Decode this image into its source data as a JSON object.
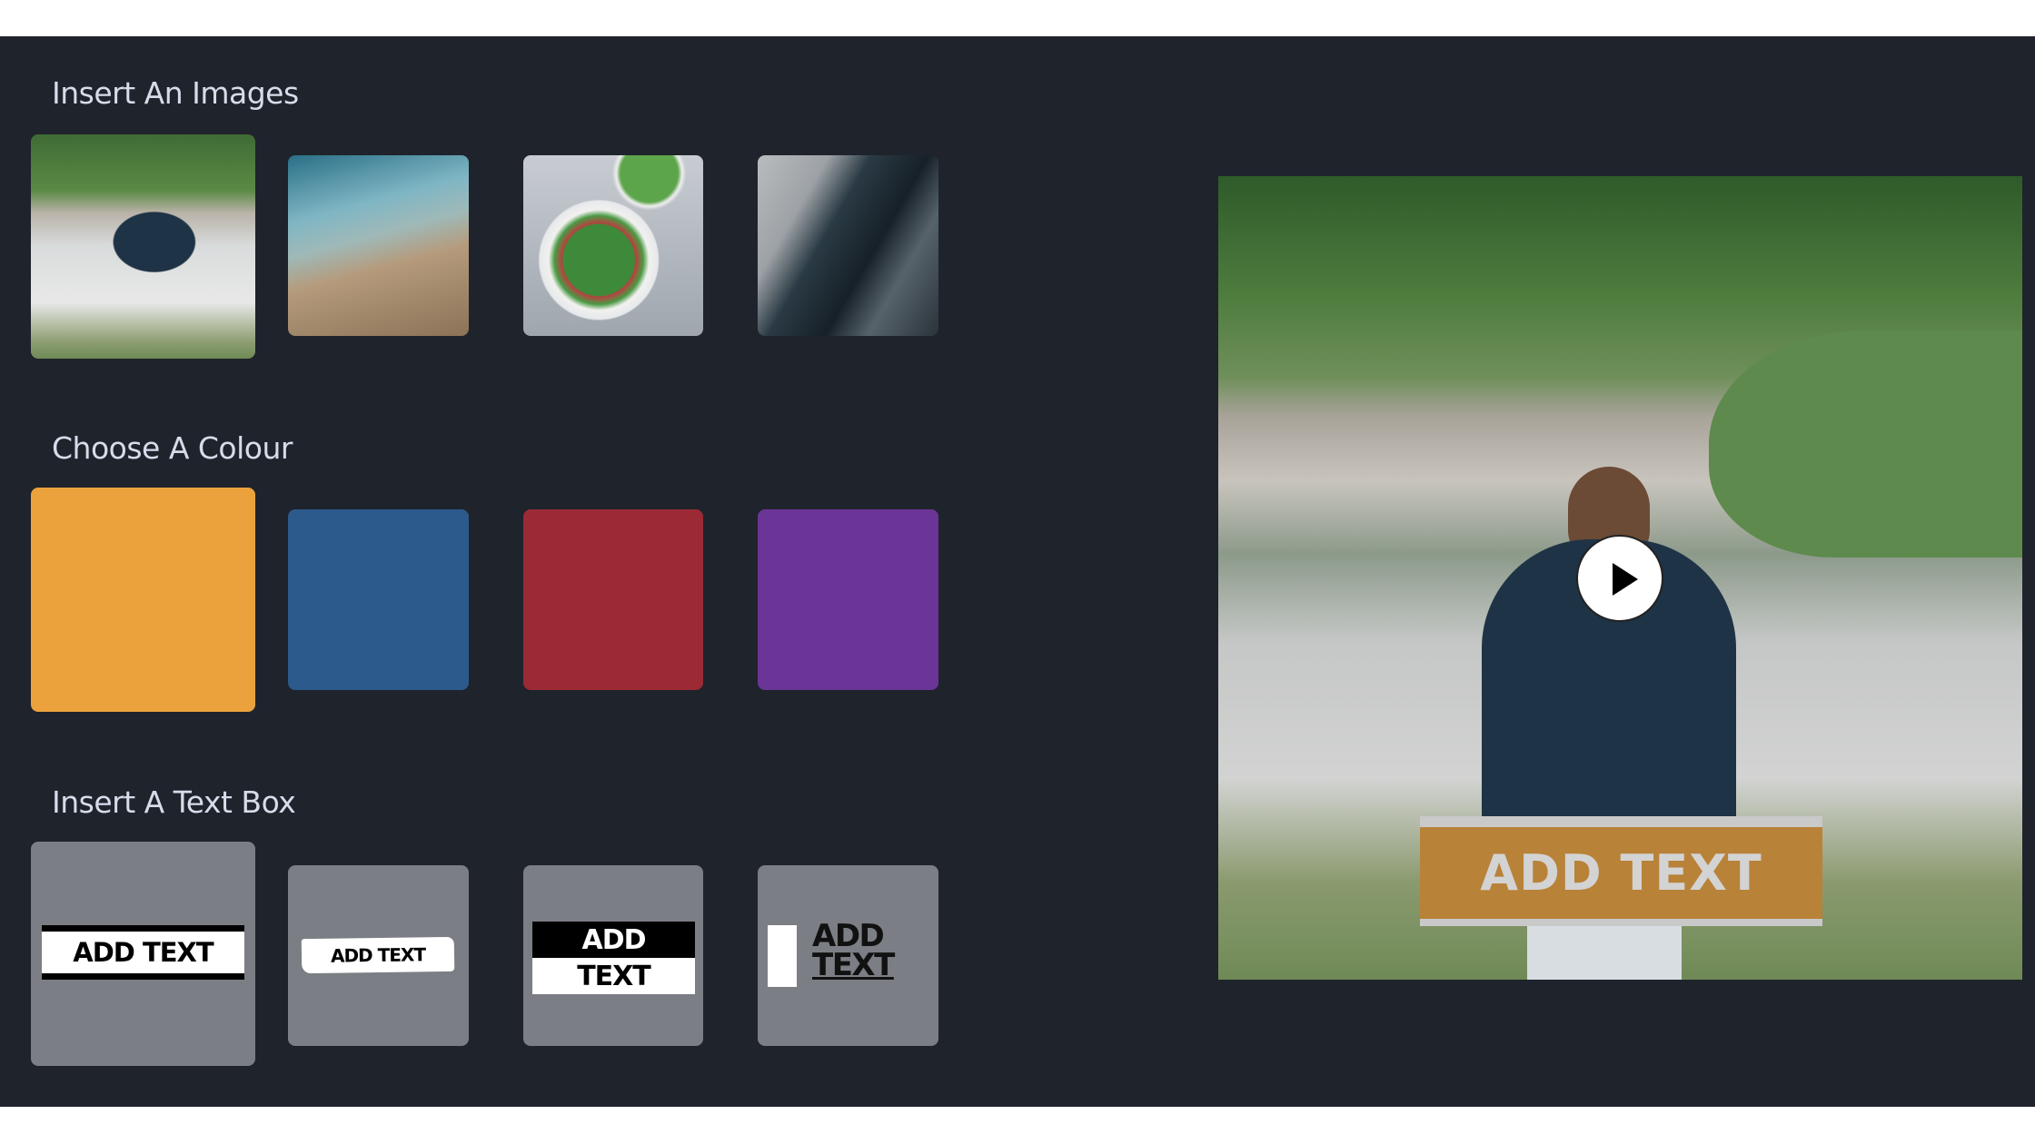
{
  "sections": {
    "images": {
      "title": "Insert An Images",
      "items": [
        "runner",
        "beach-friends",
        "salad",
        "building"
      ],
      "selected": 0
    },
    "colours": {
      "title": "Choose A Colour",
      "items": [
        "#eba23d",
        "#2d5a8c",
        "#9b2a35",
        "#6b3598"
      ],
      "selected": 0
    },
    "textboxes": {
      "title": "Insert A Text Box",
      "selected": 0,
      "styles": [
        {
          "label": "ADD TEXT"
        },
        {
          "label": "ADD TEXT"
        },
        {
          "line1": "ADD",
          "line2": "TEXT"
        },
        {
          "line1": "ADD",
          "line2": "TEXT"
        }
      ]
    }
  },
  "preview": {
    "overlay_text": "ADD TEXT",
    "overlay_color": "#b88238",
    "play_icon": "play-icon"
  },
  "colors": {
    "panel_bg": "#1f232b",
    "heading": "#d6dcea",
    "tile_gray": "#7b7e84"
  }
}
